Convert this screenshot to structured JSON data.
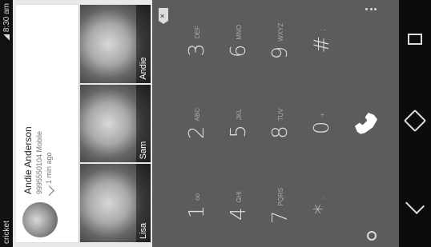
{
  "status": {
    "carrier": "cricket",
    "time": "8:30 am"
  },
  "recent": {
    "name": "Andie Anderson",
    "number": "9995550104 Mobile",
    "time": "1 min ago"
  },
  "favorites": [
    {
      "name": "Lisa"
    },
    {
      "name": "Sam"
    },
    {
      "name": "Andie"
    }
  ],
  "dialpad": {
    "keys": [
      {
        "digit": "1",
        "letters": "oo"
      },
      {
        "digit": "2",
        "letters": "ABC"
      },
      {
        "digit": "3",
        "letters": "DEF"
      },
      {
        "digit": "4",
        "letters": "GHI"
      },
      {
        "digit": "5",
        "letters": "JKL"
      },
      {
        "digit": "6",
        "letters": "MNO"
      },
      {
        "digit": "7",
        "letters": "PQRS"
      },
      {
        "digit": "8",
        "letters": "TUV"
      },
      {
        "digit": "9",
        "letters": "WXYZ"
      },
      {
        "digit": "*",
        "letters": ","
      },
      {
        "digit": "0",
        "letters": "+"
      },
      {
        "digit": "#",
        "letters": ";"
      }
    ],
    "backspace_symbol": "×"
  },
  "icons": {
    "call": "phone-icon",
    "back": "back-icon",
    "home": "home-icon",
    "recents": "recents-icon",
    "timer": "timer-icon",
    "menu": "overflow-menu-icon"
  }
}
